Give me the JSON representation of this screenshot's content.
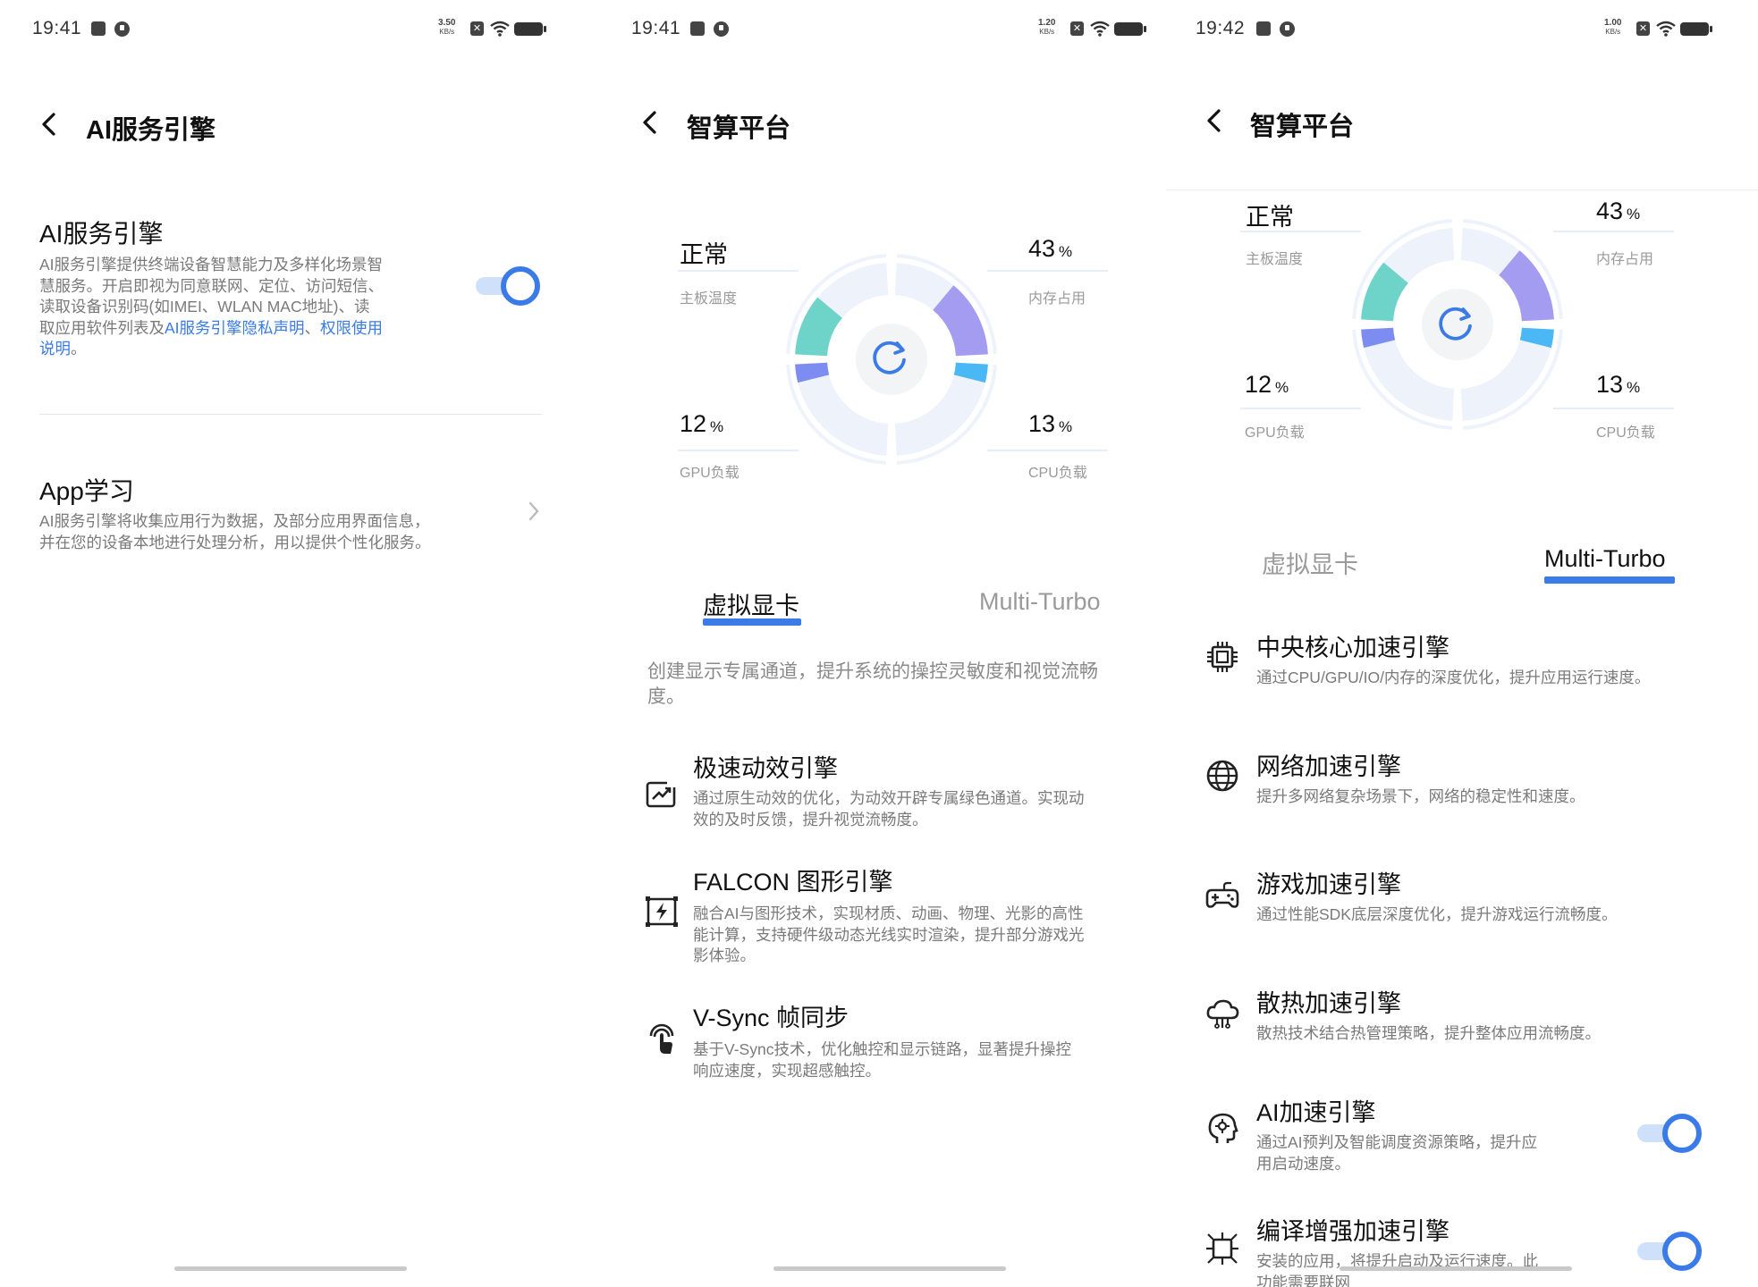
{
  "colors": {
    "accent": "#3b7be8",
    "teal": "#6ed3c9",
    "purple": "#a49cf0",
    "cyan": "#49b8f4",
    "indigo": "#7d8cf0",
    "ring_light": "#eef2fb"
  },
  "screen1": {
    "status": {
      "time": "19:41",
      "speed": "3.50",
      "speed_unit": "KB/s"
    },
    "header": {
      "title": "AI服务引擎",
      "back_icon": "back-arrow-icon"
    },
    "section1": {
      "title": "AI服务引擎",
      "desc_lines": [
        "AI服务引擎提供终端设备智慧能力及多样化场景智",
        "慧服务。开启即视为同意联网、定位、访问短信、",
        "读取设备识别码(如IMEI、WLAN MAC地址)、读"
      ],
      "desc_line4_prefix": "取应用软件列表及",
      "link1": "AI服务引擎隐私声明",
      "sep": "、",
      "link2_a": "权限使用",
      "link2_b": "说明",
      "desc_end": "。",
      "toggle_on": true
    },
    "section2": {
      "title": "App学习",
      "desc_lines": [
        "AI服务引擎将收集应用行为数据，及部分应用界面信息，",
        "并在您的设备本地进行处理分析，用以提供个性化服务。"
      ],
      "chevron_icon": "chevron-right-icon"
    }
  },
  "screen2": {
    "status": {
      "time": "19:41",
      "speed": "1.20",
      "speed_unit": "KB/s"
    },
    "header": {
      "title": "智算平台"
    },
    "gauge": {
      "board_temp": {
        "value": "正常",
        "label": "主板温度"
      },
      "memory": {
        "value": "43",
        "unit": "%",
        "label": "内存占用"
      },
      "gpu": {
        "value": "12",
        "unit": "%",
        "label": "GPU负载"
      },
      "cpu": {
        "value": "13",
        "unit": "%",
        "label": "CPU负载"
      },
      "refresh_icon": "refresh-icon"
    },
    "tabs": [
      {
        "label": "虚拟显卡",
        "active": true
      },
      {
        "label": "Multi-Turbo",
        "active": false
      }
    ],
    "intro_lines": [
      "创建显示专属通道，提升系统的操控灵敏度和视觉流畅",
      "度。"
    ],
    "features": [
      {
        "icon": "trend-chart-icon",
        "title": "极速动效引擎",
        "desc": [
          "通过原生动效的优化，为动效开辟专属绿色通道。实现动",
          "效的及时反馈，提升视觉流畅度。"
        ]
      },
      {
        "icon": "lightning-frame-icon",
        "title": "FALCON 图形引擎",
        "desc": [
          "融合AI与图形技术，实现材质、动画、物理、光影的高性",
          "能计算，支持硬件级动态光线实时渲染，提升部分游戏光",
          "影体验。"
        ]
      },
      {
        "icon": "touch-hand-icon",
        "title": "V-Sync 帧同步",
        "desc": [
          "基于V-Sync技术，优化触控和显示链路，显著提升操控",
          "响应速度，实现超感触控。"
        ]
      }
    ]
  },
  "screen3": {
    "status": {
      "time": "19:42",
      "speed": "1.00",
      "speed_unit": "KB/s"
    },
    "header": {
      "title": "智算平台"
    },
    "gauge": {
      "board_temp": {
        "value": "正常",
        "label": "主板温度"
      },
      "memory": {
        "value": "43",
        "unit": "%",
        "label": "内存占用"
      },
      "gpu": {
        "value": "12",
        "unit": "%",
        "label": "GPU负载"
      },
      "cpu": {
        "value": "13",
        "unit": "%",
        "label": "CPU负载"
      }
    },
    "tabs": [
      {
        "label": "虚拟显卡",
        "active": false
      },
      {
        "label": "Multi-Turbo",
        "active": true
      }
    ],
    "features": [
      {
        "icon": "cpu-chip-icon",
        "title": "中央核心加速引擎",
        "desc": [
          "通过CPU/GPU/IO/内存的深度优化，提升应用运行速度。"
        ],
        "toggle": false
      },
      {
        "icon": "globe-icon",
        "title": "网络加速引擎",
        "desc": [
          "提升多网络复杂场景下，网络的稳定性和速度。"
        ],
        "toggle": false
      },
      {
        "icon": "gamepad-icon",
        "title": "游戏加速引擎",
        "desc": [
          "通过性能SDK底层深度优化，提升游戏运行流畅度。"
        ],
        "toggle": false
      },
      {
        "icon": "cloud-cooling-icon",
        "title": "散热加速引擎",
        "desc": [
          "散热技术结合热管理策略，提升整体应用流畅度。"
        ],
        "toggle": false
      },
      {
        "icon": "ai-head-icon",
        "title": "AI加速引擎",
        "desc": [
          "通过AI预判及智能调度资源策略，提升应",
          "用启动速度。"
        ],
        "toggle": true
      },
      {
        "icon": "compile-chip-icon",
        "title": "编译增强加速引擎",
        "desc": [
          "安装的应用，将提升启动及运行速度。此",
          "功能需要联网"
        ],
        "toggle": true
      }
    ]
  }
}
